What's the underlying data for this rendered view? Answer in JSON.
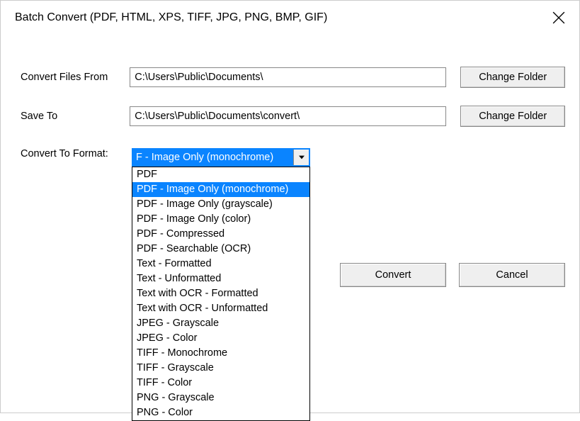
{
  "window": {
    "title": "Batch Convert (PDF, HTML, XPS, TIFF, JPG, PNG, BMP, GIF)"
  },
  "fields": {
    "from_label": "Convert Files From",
    "from_value": "C:\\Users\\Public\\Documents\\",
    "from_change": "Change Folder",
    "save_label": "Save To",
    "save_value": "C:\\Users\\Public\\Documents\\convert\\",
    "save_change": "Change Folder",
    "format_label": "Convert To Format:",
    "format_selected": "F - Image Only (monochrome)"
  },
  "format_options": [
    "PDF",
    "PDF - Image Only (monochrome)",
    "PDF - Image Only (grayscale)",
    "PDF - Image Only (color)",
    "PDF - Compressed",
    "PDF - Searchable (OCR)",
    "Text - Formatted",
    "Text - Unformatted",
    "Text with OCR - Formatted",
    "Text with OCR - Unformatted",
    "JPEG - Grayscale",
    "JPEG - Color",
    "TIFF - Monochrome",
    "TIFF - Grayscale",
    "TIFF - Color",
    "PNG - Grayscale",
    "PNG - Color"
  ],
  "format_selected_index": 1,
  "buttons": {
    "convert": "Convert",
    "cancel": "Cancel"
  }
}
